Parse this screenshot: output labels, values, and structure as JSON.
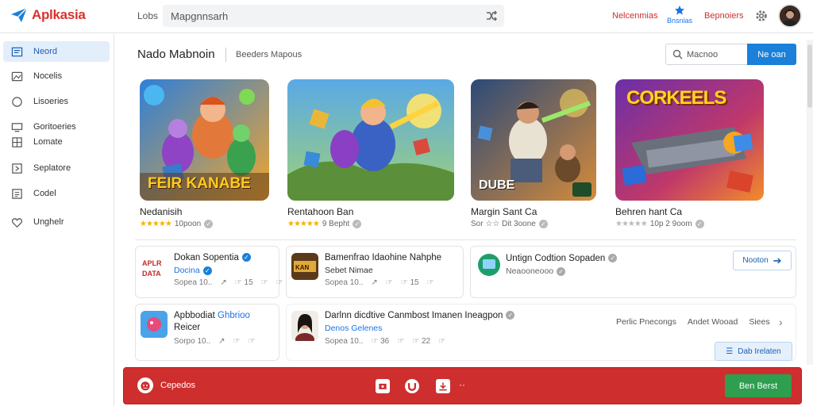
{
  "header": {
    "logo_text": "Aplkasia",
    "label": "Lobs",
    "search_value": "Mapgnnsarh",
    "nav_link_1": "Nelcenmias",
    "nav_star_label": "Bnsnias",
    "nav_link_2": "Bepnoiers"
  },
  "sidebar": {
    "items": [
      {
        "label": "Neord",
        "icon": "list-icon"
      },
      {
        "label": "Nocelis",
        "icon": "photo-icon"
      },
      {
        "label": "Lisoeries",
        "icon": "circle-icon"
      },
      {
        "label": "Goritoeries",
        "icon": "desktop-icon"
      },
      {
        "label": "Lomate",
        "icon": "grid-icon"
      },
      {
        "label": "Seplatore",
        "icon": "share-icon"
      },
      {
        "label": "Codel",
        "icon": "document-icon"
      },
      {
        "label": "Unghelr",
        "icon": "heart-icon"
      }
    ]
  },
  "toolbar": {
    "title": "Nado Mabnoin",
    "subtitle": "Beeders  Mapous",
    "filter_placeholder": "Macnoo",
    "filter_button": "Ne oan"
  },
  "featured": [
    {
      "title": "Nedanisih",
      "rating_text": "10poon",
      "stars": "★★★★★",
      "art_text": "FEIR KANABE"
    },
    {
      "title": "Rentahoon Ban",
      "rating_text": "9 Bepht",
      "stars": "★★★★★",
      "art_text": ""
    },
    {
      "title": "Margin Sant Ca",
      "rating_text": "Sor ☆☆ Dit 3oone",
      "stars": "",
      "art_text": "DUBE"
    },
    {
      "title": "Behren hant Ca",
      "rating_text": "10p 2 9oom",
      "stars": "★★★★★",
      "art_text": "CORKEELS"
    }
  ],
  "list": [
    {
      "name": "Dokan Sopentia",
      "sub": "Docina",
      "stats": [
        "Sopea 10..",
        "↗",
        "☞ 15",
        "☞",
        "☞"
      ]
    },
    {
      "name": "Bamenfrao Idaohine Nahphe",
      "sub": "Sebet Nimae",
      "stats": [
        "Sopea 10..",
        "↗",
        "☞",
        "☞ 15",
        "☞"
      ]
    },
    {
      "name": "Untign Codtion Sopaden",
      "sub": "Neaooneooo",
      "stats": []
    },
    {
      "name": "Apbbodiat",
      "name_link": "Ghbrioo",
      "sub": "Reicer",
      "stats": [
        "Sorpo 10..",
        "↗",
        "☞",
        "☞"
      ]
    },
    {
      "name": "Darlnn dicdtive Canmbost Imanen Ineagpon",
      "sub": "Denos Gelenes",
      "stats": [
        "Sopea 10..",
        "☞ 36",
        "☞",
        "☞ 22",
        "☞"
      ]
    }
  ],
  "actions": {
    "tile_button": "Nooton",
    "links": [
      "Perlic Pnecongs",
      "Andet Wooad",
      "Siees"
    ],
    "label_button": "Dab Irelaten"
  },
  "bottom_bar": {
    "label": "Cepedos",
    "cta": "Ben Berst"
  },
  "colors": {
    "brand": "#d8322f",
    "accent": "#1a80d9",
    "bottom_bar": "#cf2e2e",
    "cta": "#2e9e4f"
  }
}
